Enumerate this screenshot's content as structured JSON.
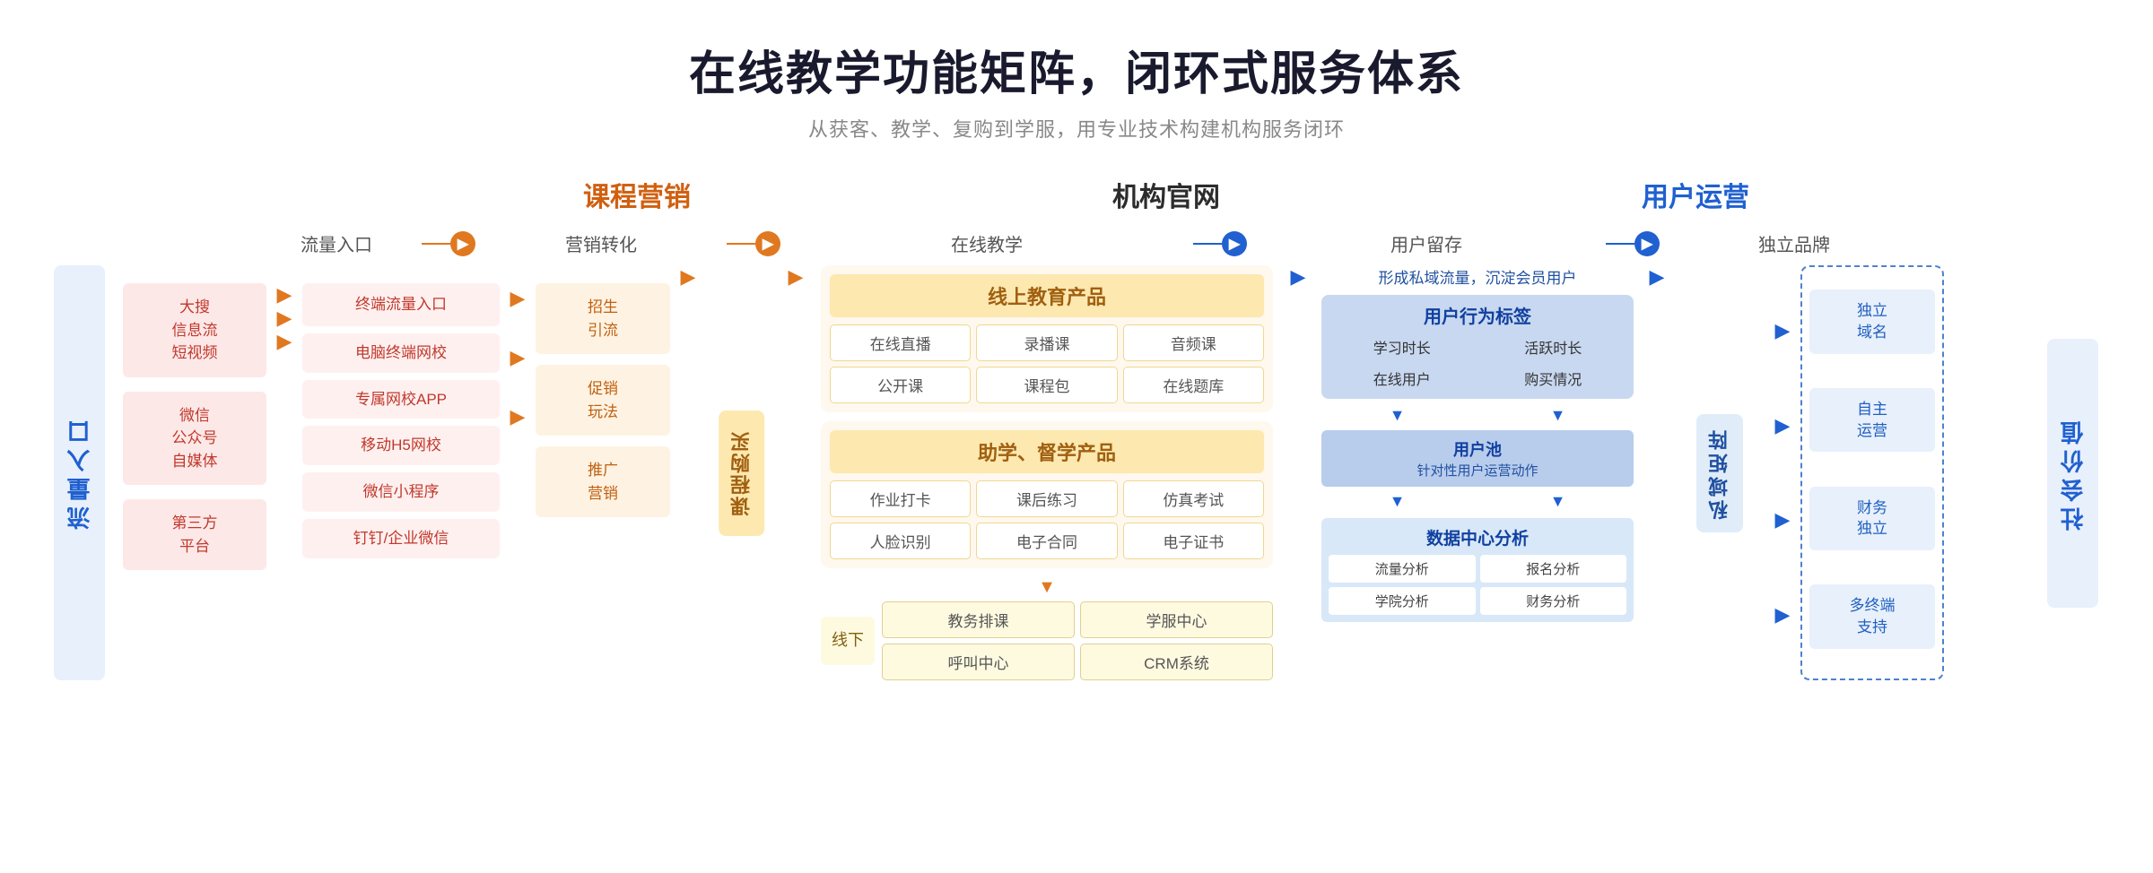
{
  "header": {
    "title": "在线教学功能矩阵，闭环式服务体系",
    "subtitle": "从获客、教学、复购到学服，用专业技术构建机构服务闭环"
  },
  "sections": {
    "marketing": "课程营销",
    "institution": "机构官网",
    "user_ops": "用户运营"
  },
  "flow_steps": [
    "流量入口",
    "营销转化",
    "在线教学",
    "用户留存",
    "独立品牌"
  ],
  "left_label": "流量入口",
  "traffic_sources": [
    {
      "name": "大搜信息流短视频",
      "type": "pink"
    },
    {
      "name": "微信公众号自媒体",
      "type": "pink"
    },
    {
      "name": "第三方平台",
      "type": "pink"
    }
  ],
  "marketing_items": [
    {
      "name": "终端流量入口"
    },
    {
      "name": "电脑终端网校"
    },
    {
      "name": "专属网校APP"
    },
    {
      "name": "移动H5网校"
    },
    {
      "name": "微信小程序"
    },
    {
      "name": "钉钉/企业微信"
    }
  ],
  "promo_items": [
    {
      "name": "招生引流"
    },
    {
      "name": "促销玩法"
    },
    {
      "name": "推广营销"
    }
  ],
  "course_buy_label": "课程购买",
  "online_edu": {
    "title": "线上教育产品",
    "items": [
      "在线直播",
      "录播课",
      "音频课",
      "公开课",
      "课程包",
      "在线题库"
    ]
  },
  "assist_learn": {
    "title": "助学、督学产品",
    "items": [
      "作业打卡",
      "课后练习",
      "仿真考试",
      "人脸识别",
      "电子合同",
      "电子证书"
    ]
  },
  "offline": {
    "title": "线下",
    "items": [
      "教务排课",
      "学服中心",
      "呼叫中心",
      "CRM系统"
    ]
  },
  "user_behavior": {
    "intro": "形成私域流量，沉淀会员用户",
    "title": "用户行为标签",
    "items": [
      "学习时长",
      "活跃时长",
      "在线用户",
      "购买情况"
    ]
  },
  "user_pool": {
    "title": "用户池",
    "sub": "针对性用户运营动作"
  },
  "data_center": {
    "title": "数据中心分析",
    "items": [
      "流量分析",
      "报名分析",
      "学院分析",
      "财务分析"
    ]
  },
  "private_matrix": "私域矩阵",
  "brand_items": [
    {
      "name": "独立域名"
    },
    {
      "name": "自主运营"
    },
    {
      "name": "财务独立"
    },
    {
      "name": "多终端支持"
    }
  ],
  "social_value": "社会价值"
}
